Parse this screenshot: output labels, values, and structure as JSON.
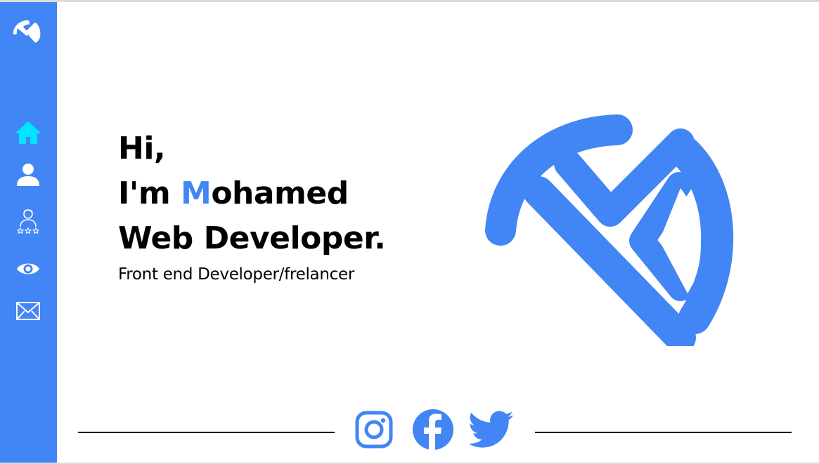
{
  "colors": {
    "accent": "#4285f4",
    "nav_active": "#00e5ff",
    "nav_icon": "#ffffff",
    "text": "#000000"
  },
  "sidebar": {
    "logo": "brand-logo-icon",
    "items": [
      {
        "name": "home",
        "icon": "home-icon",
        "active": true
      },
      {
        "name": "about",
        "icon": "user-icon",
        "active": false
      },
      {
        "name": "services",
        "icon": "rated-person-icon",
        "active": false
      },
      {
        "name": "portfolio",
        "icon": "eye-icon",
        "active": false
      },
      {
        "name": "contact",
        "icon": "envelope-icon",
        "active": false
      }
    ]
  },
  "hero": {
    "greeting": "Hi,",
    "intro_prefix": "I'm ",
    "name_initial": "M",
    "name_rest": "ohamed",
    "role": "Web Developer.",
    "subtitle": "Front end Developer/frelancer"
  },
  "social": [
    {
      "name": "instagram",
      "icon": "instagram-icon"
    },
    {
      "name": "facebook",
      "icon": "facebook-icon"
    },
    {
      "name": "twitter",
      "icon": "twitter-icon"
    }
  ]
}
